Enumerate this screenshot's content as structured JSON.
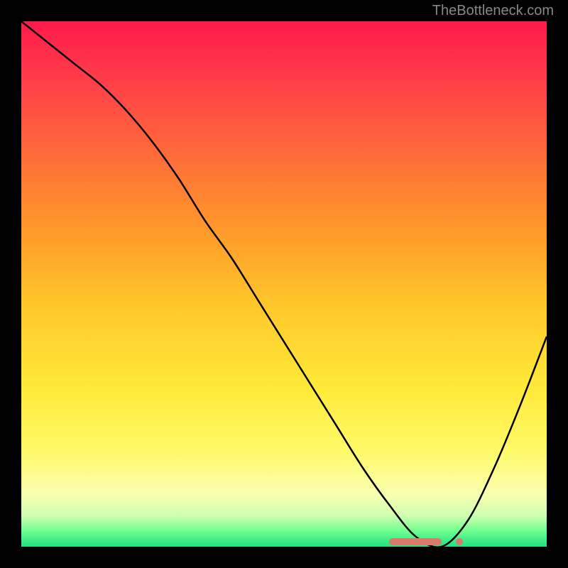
{
  "watermark": "TheBottleneck.com",
  "chart_data": {
    "type": "line",
    "title": "",
    "xlabel": "",
    "ylabel": "",
    "xlim": [
      0,
      100
    ],
    "ylim": [
      0,
      100
    ],
    "x": [
      0,
      5,
      10,
      15,
      20,
      25,
      30,
      35,
      40,
      45,
      50,
      55,
      60,
      65,
      70,
      75,
      80,
      85,
      90,
      95,
      100
    ],
    "values": [
      100,
      96,
      92,
      88,
      83,
      77,
      70,
      62,
      55,
      47,
      39,
      31,
      23,
      15,
      8,
      2,
      0,
      5,
      15,
      27,
      40
    ],
    "minimum_marker": {
      "x_start": 70,
      "x_end": 80,
      "y": 1
    },
    "gradient_stops": [
      {
        "pos": 0,
        "color": "#ff1a4a"
      },
      {
        "pos": 50,
        "color": "#ffca2a"
      },
      {
        "pos": 90,
        "color": "#fffa6a"
      },
      {
        "pos": 100,
        "color": "#20e080"
      }
    ]
  }
}
